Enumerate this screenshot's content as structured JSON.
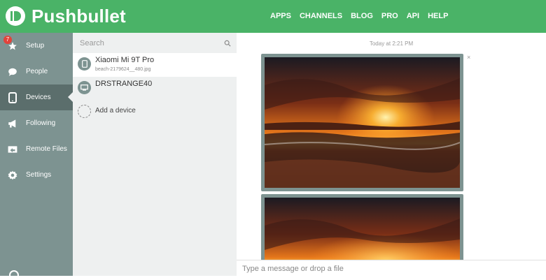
{
  "header": {
    "brand": "Pushbullet",
    "nav": [
      "APPS",
      "CHANNELS",
      "BLOG",
      "PRO",
      "API",
      "HELP"
    ]
  },
  "sidebar": {
    "badge": "7",
    "items": [
      {
        "label": "Setup",
        "icon": "star-icon"
      },
      {
        "label": "People",
        "icon": "chat-bubble-icon"
      },
      {
        "label": "Devices",
        "icon": "phone-icon",
        "active": true
      },
      {
        "label": "Following",
        "icon": "megaphone-icon"
      },
      {
        "label": "Remote Files",
        "icon": "folder-icon"
      },
      {
        "label": "Settings",
        "icon": "gear-icon"
      }
    ]
  },
  "devices": {
    "search_placeholder": "Search",
    "list": [
      {
        "name": "Xiaomi Mi 9T Pro",
        "sub": "beach-2179624__480.jpg",
        "icon": "phone-icon"
      },
      {
        "name": "DRSTRANGE40",
        "sub": "",
        "icon": "desktop-icon"
      }
    ],
    "add_label": "Add a device"
  },
  "chat": {
    "timestamp": "Today at 2:21 PM",
    "close": "×",
    "composer_placeholder": "Type a message or drop a file"
  },
  "colors": {
    "header": "#4ab367",
    "sidebar": "#7d9391",
    "sidebar_active": "#5b6e6c",
    "list_bg": "#eef0f0",
    "badge": "#e2433b"
  }
}
